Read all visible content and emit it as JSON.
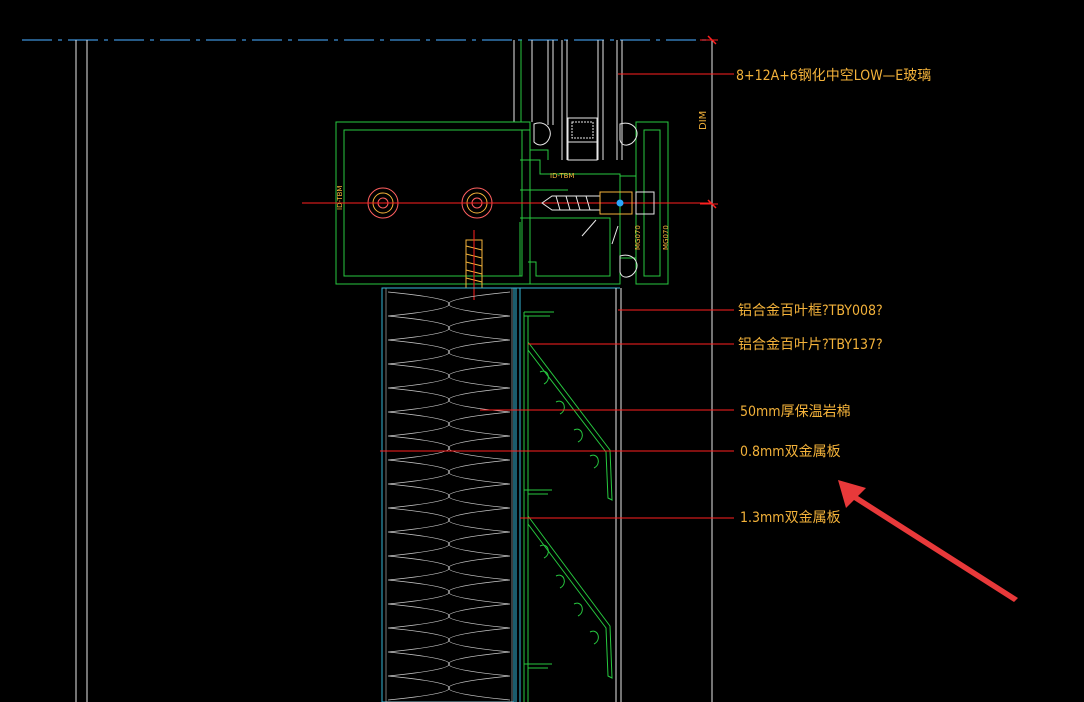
{
  "drawing": {
    "background": "#000000",
    "colors": {
      "profile": "#27c93f",
      "insulation": "#c8c8c8",
      "panel": "#36b7d8",
      "leader": "#ff2020",
      "text": "#f3b23a",
      "white_line": "#e8e8e8",
      "arrow": "#e8393a"
    },
    "annotations": [
      {
        "id": "glass",
        "text": "8+12A+6钢化中空LOW—E玻璃"
      },
      {
        "id": "louver-frame",
        "text": "铝合金百叶框?TBY008?"
      },
      {
        "id": "louver-blade",
        "text": "铝合金百叶片?TBY137?"
      },
      {
        "id": "rock-wool",
        "text": "50mm厚保温岩棉"
      },
      {
        "id": "metal-08",
        "text": "0.8mm双金属板"
      },
      {
        "id": "metal-13",
        "text": "1.3mm双金属板"
      }
    ],
    "dimension_text": "DIM",
    "profile_tags": [
      "ID-TBM",
      "ID-TBM",
      "MG070",
      "MG070"
    ]
  }
}
